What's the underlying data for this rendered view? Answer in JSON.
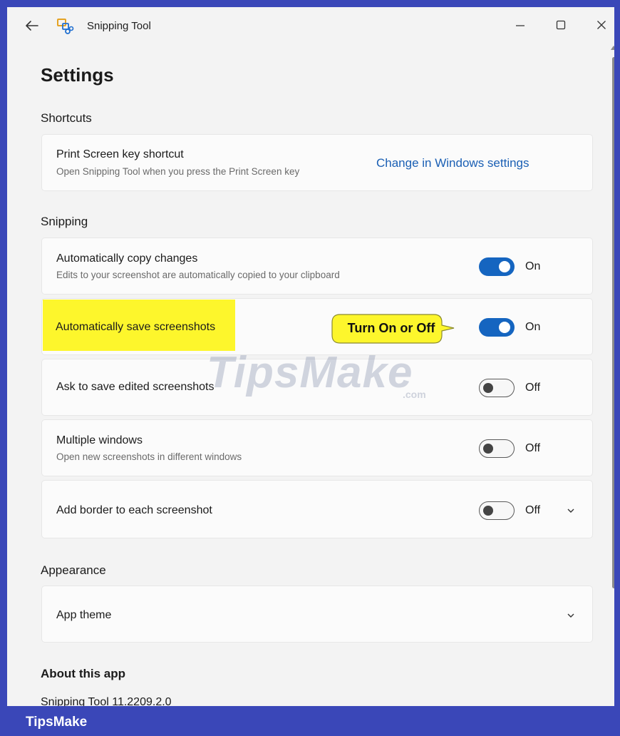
{
  "window": {
    "app_title": "Snipping Tool",
    "back_icon": "back-arrow-icon",
    "app_icon": "snipping-tool-icon",
    "minimize_icon": "minimize-icon",
    "maximize_icon": "maximize-icon",
    "close_icon": "close-icon"
  },
  "page": {
    "title": "Settings"
  },
  "shortcuts": {
    "section_label": "Shortcuts",
    "print_screen": {
      "title": "Print Screen key shortcut",
      "desc": "Open Snipping Tool when you press the Print Screen key",
      "link": "Change in Windows settings"
    }
  },
  "snipping": {
    "section_label": "Snipping",
    "auto_copy": {
      "title": "Automatically copy changes",
      "desc": "Edits to your screenshot are automatically copied to your clipboard",
      "state": "On",
      "enabled": true
    },
    "auto_save": {
      "title": "Automatically save screenshots",
      "state": "On",
      "enabled": true
    },
    "ask_save": {
      "title": "Ask to save edited screenshots",
      "state": "Off",
      "enabled": false
    },
    "multiple_windows": {
      "title": "Multiple windows",
      "desc": "Open new screenshots in different windows",
      "state": "Off",
      "enabled": false
    },
    "add_border": {
      "title": "Add border to each screenshot",
      "state": "Off",
      "enabled": false
    }
  },
  "appearance": {
    "section_label": "Appearance",
    "app_theme": {
      "title": "App theme"
    }
  },
  "about": {
    "section_label": "About this app",
    "version": "Snipping Tool 11.2209.2.0"
  },
  "annotation": {
    "callout": "Turn On or Off",
    "highlight_color": "#fdf62c"
  },
  "branding": {
    "watermark": "TipsMake",
    "watermark_domain": ".com",
    "footer": "TipsMake",
    "frame_color": "#3a47b8"
  },
  "colors": {
    "accent": "#1565c0",
    "link": "#1a5fb4"
  }
}
